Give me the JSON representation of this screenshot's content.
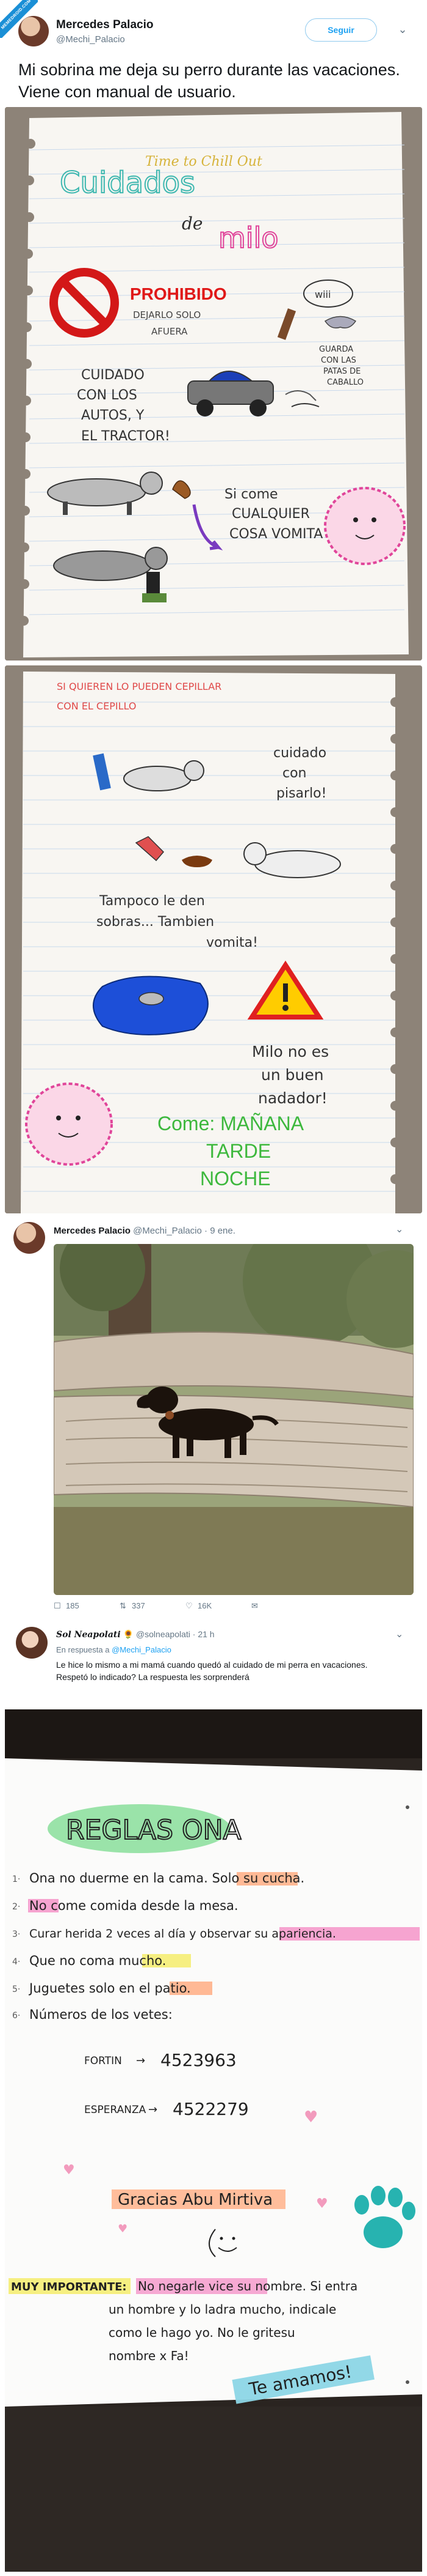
{
  "badge": {
    "text": "MEMEDROID.COM"
  },
  "tweet1": {
    "name": "Mercedes Palacio",
    "handle": "@Mechi_Palacio",
    "follow_label": "Seguir",
    "text": "Mi sobrina me deja su perro durante las vacaciones. Viene con manual de usuario."
  },
  "manual_page1": {
    "title_top": "Time to Chill Out",
    "title_main": "Cuidados",
    "title_de": "de",
    "title_name": "milo",
    "prohibido": "PROHIBIDO",
    "prohibido_sub1": "DEJARLO SOLO",
    "prohibido_sub2": "AFUERA",
    "wiii": "wiii",
    "guarda_1": "GUARDA",
    "guarda_2": "CON LAS",
    "guarda_3": "PATAS DE",
    "guarda_4": "CABALLO",
    "cuidado_1": "CUIDADO",
    "cuidado_2": "CON LOS",
    "cuidado_3": "AUTOS, Y",
    "cuidado_4": "EL TRACTOR!",
    "si_come_1": "Si come",
    "si_come_2": "CUALQUIER",
    "si_come_3": "COSA VOMITA"
  },
  "manual_page2": {
    "top_1": "SI QUIEREN LO PUEDEN CEPILLAR",
    "top_2": "CON EL CEPILLO",
    "cuidado_1": "cuidado",
    "cuidado_2": "con",
    "cuidado_3": "pisarlo!",
    "tampoco_1": "Tampoco le den",
    "tampoco_2": "sobras... Tambien",
    "tampoco_3": "vomita!",
    "milo_1": "Milo no es",
    "milo_2": "un buen",
    "milo_3": "nadador!",
    "come_1": "Come: MAÑANA",
    "come_2": "TARDE",
    "come_3": "NOCHE"
  },
  "tweet2": {
    "name": "Mercedes Palacio",
    "handle": "@Mechi_Palacio",
    "date": "· 9 ene.",
    "replies": "185",
    "retweets": "337",
    "likes": "16K"
  },
  "reply": {
    "name": "Sol Neapolati",
    "emoji": "🌻",
    "handle": "@solneapolati",
    "time": "· 21 h",
    "replying_prefix": "En respuesta a",
    "replying_to": "@Mechi_Palacio",
    "text_1": "Le hice lo mismo a mi mamá cuando quedó al cuidado de mi perra en vacaciones.",
    "text_2": "Respetó lo indicado? La respuesta les sorprenderá"
  },
  "notebook": {
    "title": "REGLAS ONA",
    "rule1": "Ona no duerme en la cama. Solo su cucha.",
    "rule2": "No come comida desde la mesa.",
    "rule3": "Curar herida 2 veces al día y observar su apariencia.",
    "rule4": "Que no coma mucho.",
    "rule5": "Juguetes solo en el patio.",
    "vets": "Números de los vetes:",
    "vet1_name": "FORTIN",
    "vet1_num": "4523963",
    "vet2_name": "ESPERANZA",
    "vet2_num": "4522279",
    "gracias": "Gracias Abu Mirtiva",
    "importante_label": "MUY IMPORTANTE:",
    "importante_1": "No negarle vice su nombre. Si entra",
    "importante_2": "un hombre y lo ladra mucho, indicale",
    "importante_3": "como le hago yo. No le gritesu",
    "importante_4": "nombre x Fa!",
    "amamos": "Te amamos!"
  },
  "colors": {
    "twitter_blue": "#1da1f2",
    "text_dark": "#14171a",
    "text_gray": "#657786",
    "highlighter_green": "#8fe0a0",
    "highlighter_pink": "#f59acb",
    "highlighter_orange": "#ffb18a",
    "highlighter_yellow": "#f6ee7a",
    "teal": "#27b3b0"
  },
  "icons": [
    "chevron-down-icon",
    "reply-icon",
    "retweet-icon",
    "heart-icon",
    "no-sign-icon",
    "warning-triangle-icon",
    "paw-icon"
  ]
}
